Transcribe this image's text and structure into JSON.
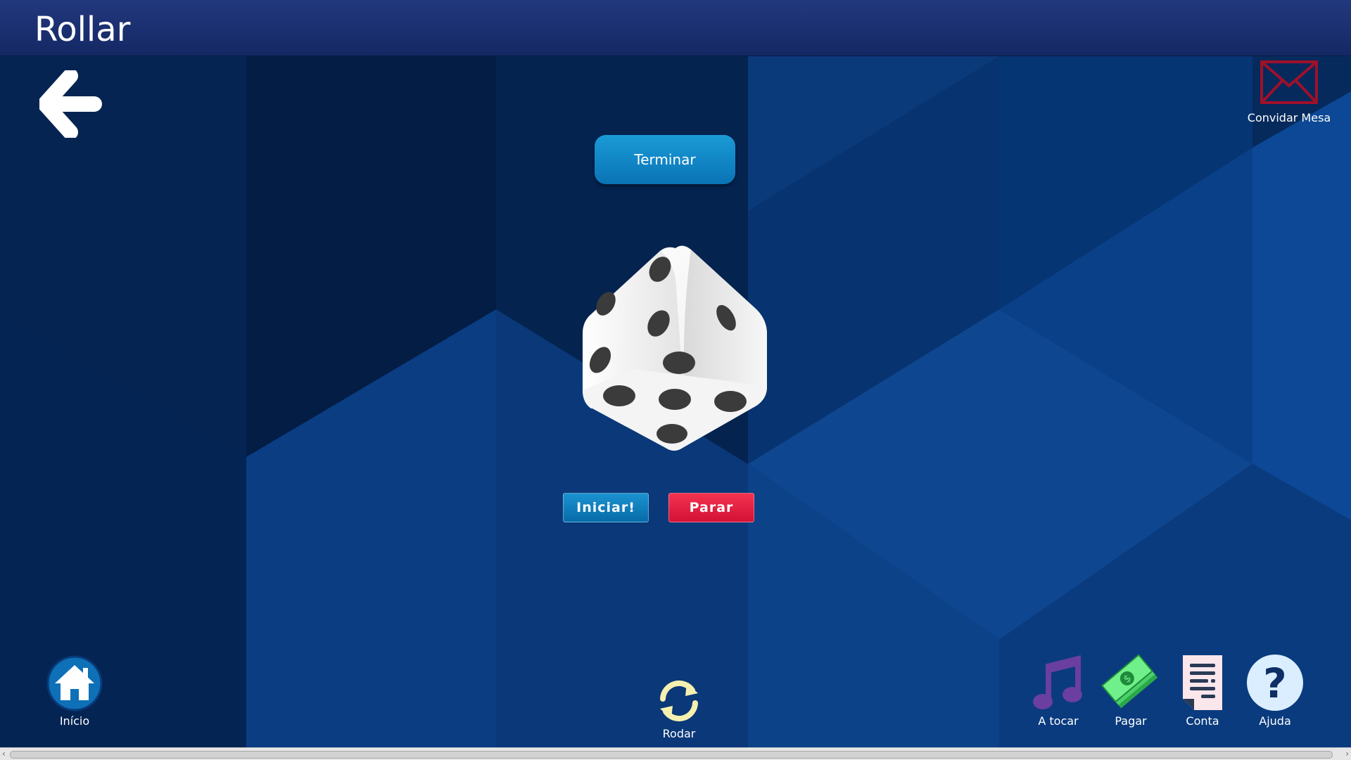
{
  "header": {
    "title": "Rollar"
  },
  "top_right": {
    "invite_label": "Convidar Mesa"
  },
  "actions": {
    "terminar_label": "Terminar",
    "iniciar_label": "Iniciar!",
    "parar_label": "Parar"
  },
  "bottom_nav": {
    "home_label": "Início",
    "rotate_label": "Rodar",
    "playing_label": "A tocar",
    "pay_label": "Pagar",
    "account_label": "Conta",
    "help_label": "Ajuda"
  },
  "icons": [
    "back-arrow-icon",
    "envelope-icon",
    "dice-icon",
    "home-icon",
    "rotate-icon",
    "music-note-icon",
    "money-icon",
    "receipt-icon",
    "help-icon"
  ],
  "colors": {
    "background": "#0a3570",
    "header": "#1b3273",
    "terminar": "#0f86c6",
    "iniciar": "#1283c3",
    "parar": "#e41e3f",
    "envelope": "#a0102a"
  }
}
